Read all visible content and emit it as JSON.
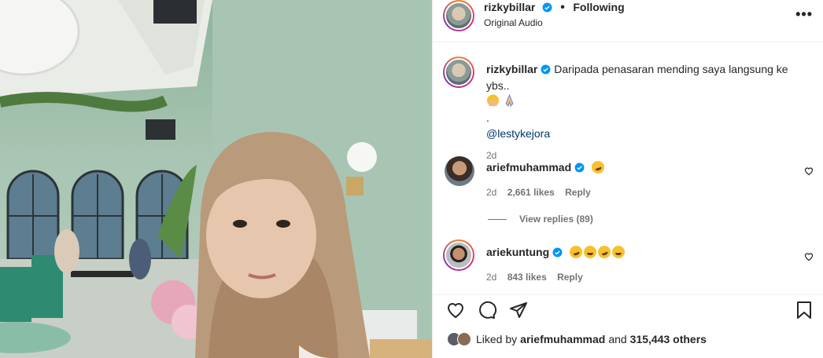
{
  "post": {
    "username": "rizkybillar",
    "follow_status": "Following",
    "audio": "Original Audio",
    "more_label": "•••"
  },
  "caption": {
    "username": "rizkybillar",
    "text": "Daripada penasaran mending saya langsung ke ybs..",
    "dot": ".",
    "mention": "@lestykejora",
    "time": "2d"
  },
  "comments": [
    {
      "username": "ariefmuhammad",
      "time": "2d",
      "likes": "2,661 likes",
      "reply": "Reply",
      "view_replies": "View replies (89)"
    },
    {
      "username": "ariekuntung",
      "time": "2d",
      "likes": "843 likes",
      "reply": "Reply"
    }
  ],
  "liked_by": {
    "prefix": "Liked by",
    "user": "ariefmuhammad",
    "middle": "and",
    "count": "315,443 others"
  },
  "colors": {
    "verified": "#0095f6",
    "link": "#00376b",
    "muted": "#737373",
    "text": "#262626"
  },
  "icons": [
    "heart-icon",
    "comment-icon",
    "share-icon",
    "bookmark-icon",
    "verified-icon",
    "more-icon"
  ]
}
